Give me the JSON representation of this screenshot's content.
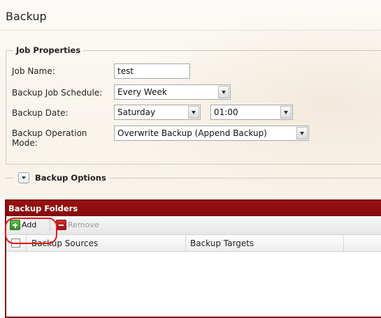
{
  "page": {
    "title": "Backup"
  },
  "job_properties": {
    "legend": "Job Properties",
    "job_name": {
      "label": "Job Name:",
      "value": "test"
    },
    "schedule": {
      "label": "Backup Job Schedule:",
      "value": "Every Week"
    },
    "date": {
      "label": "Backup Date:",
      "day_value": "Saturday",
      "time_value": "01:00"
    },
    "mode": {
      "label": "Backup Operation Mode:",
      "value": "Overwrite Backup (Append Backup)"
    }
  },
  "backup_options": {
    "label": "Backup Options",
    "icon": "chevron-down-icon"
  },
  "backup_folders": {
    "title": "Backup Folders",
    "toolbar": {
      "add_label": "Add",
      "remove_label": "Remove",
      "highlight_color": "#e01818"
    },
    "columns": [
      "Backup Sources",
      "Backup Targets"
    ]
  },
  "colors": {
    "panel_header": "#8b0e0e",
    "add_icon": "#3a9a2c",
    "remove_icon": "#b71c1c"
  }
}
